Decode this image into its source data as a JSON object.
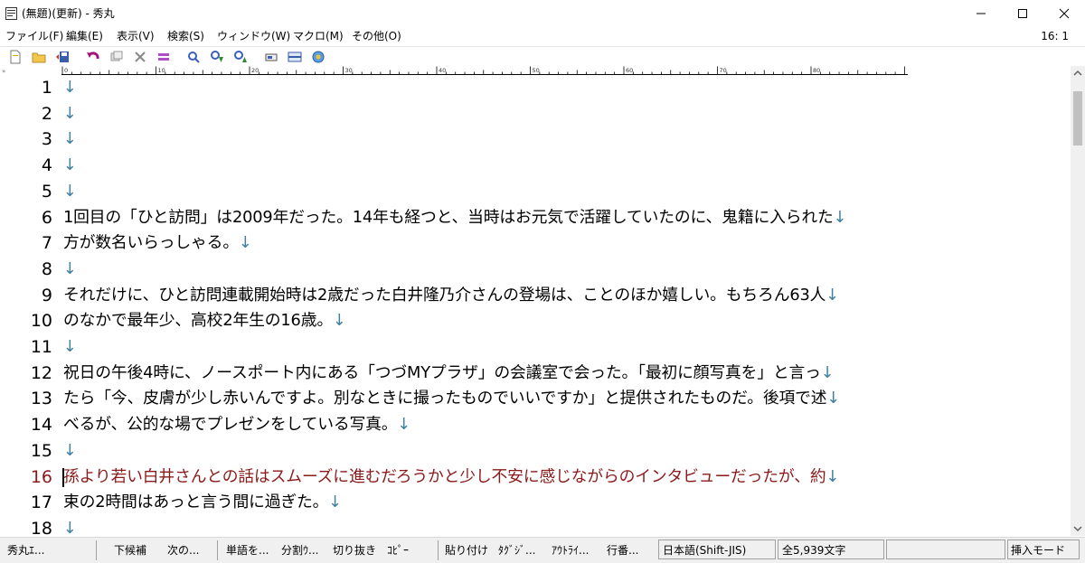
{
  "window": {
    "title": "(無題)(更新) - 秀丸"
  },
  "menu": {
    "items": [
      "ファイル(F)",
      "編集(E)",
      "表示(V)",
      "検索(S)",
      "ウィンドウ(W)",
      "マクロ(M)",
      "その他(O)"
    ],
    "cursor_position": "16: 1"
  },
  "ruler": {
    "labels": [
      "0",
      "10",
      "20",
      "30",
      "40",
      "50",
      "60",
      "70",
      "80"
    ]
  },
  "editor": {
    "arrow": "↓",
    "current_line": 16,
    "lines": [
      {
        "num": "1",
        "text": ""
      },
      {
        "num": "2",
        "text": " "
      },
      {
        "num": "3",
        "text": ""
      },
      {
        "num": "4",
        "text": ""
      },
      {
        "num": "5",
        "text": ""
      },
      {
        "num": "6",
        "text": "1回目の「ひと訪問」は2009年だった。14年も経つと、当時はお元気で活躍していたのに、鬼籍に入られた"
      },
      {
        "num": "7",
        "text": "方が数名いらっしゃる。"
      },
      {
        "num": "8",
        "text": ""
      },
      {
        "num": "9",
        "text": "それだけに、ひと訪問連載開始時は2歳だった白井隆乃介さんの登場は、ことのほか嬉しい。もちろん63人"
      },
      {
        "num": "10",
        "text": "のなかで最年少、高校2年生の16歳。"
      },
      {
        "num": "11",
        "text": ""
      },
      {
        "num": "12",
        "text": "祝日の午後4時に、ノースポート内にある「つづMYプラザ」の会議室で会った。「最初に顔写真を」と言っ"
      },
      {
        "num": "13",
        "text": "たら「今、皮膚が少し赤いんですよ。別なときに撮ったものでいいですか」と提供されたものだ。後項で述"
      },
      {
        "num": "14",
        "text": "べるが、公的な場でプレゼンをしている写真。"
      },
      {
        "num": "15",
        "text": ""
      },
      {
        "num": "16",
        "text": "孫より若い白井さんとの話はスムーズに進むだろうかと少し不安に感じながらのインタビューだったが、約"
      },
      {
        "num": "17",
        "text": "束の2時間はあっと言う間に過ぎた。"
      },
      {
        "num": "18",
        "text": ""
      }
    ]
  },
  "status": {
    "items": [
      "秀丸ｴ...",
      "下候補",
      "次の...",
      "単語を...",
      "分割ｳ...",
      "切り抜き",
      "ｺﾋﾟｰ",
      "貼り付け",
      "ﾀｸﾞｼﾞ...",
      "ｱｳﾄﾗｲ...",
      "行番..."
    ],
    "encoding": "日本語(Shift-JIS)",
    "char_count": "全5,939文字",
    "mode": "挿入モード"
  }
}
